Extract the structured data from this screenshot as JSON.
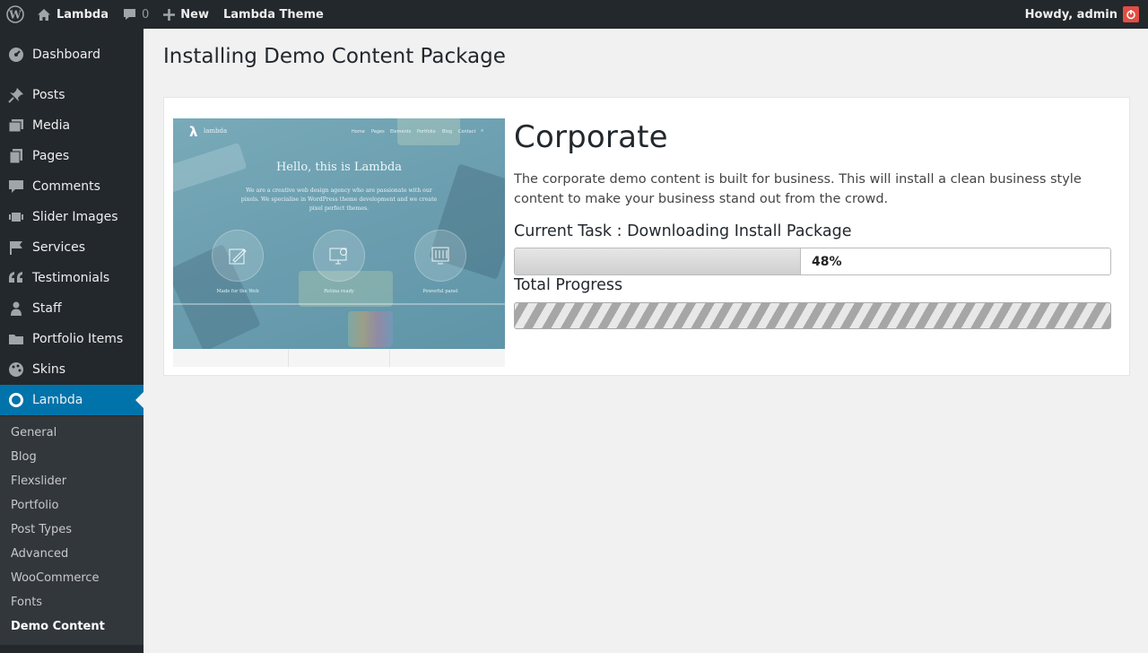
{
  "adminbar": {
    "site_name": "Lambda",
    "comments_count": "0",
    "new_label": "New",
    "theme_label": "Lambda Theme",
    "howdy": "Howdy, admin"
  },
  "sidebar": {
    "items": [
      {
        "label": "Dashboard",
        "icon": "dashboard-icon"
      },
      {
        "label": "Posts",
        "icon": "pin-icon"
      },
      {
        "label": "Media",
        "icon": "media-icon"
      },
      {
        "label": "Pages",
        "icon": "pages-icon"
      },
      {
        "label": "Comments",
        "icon": "comment-icon"
      },
      {
        "label": "Slider Images",
        "icon": "slides-icon"
      },
      {
        "label": "Services",
        "icon": "flag-icon"
      },
      {
        "label": "Testimonials",
        "icon": "quote-icon"
      },
      {
        "label": "Staff",
        "icon": "user-icon"
      },
      {
        "label": "Portfolio Items",
        "icon": "folder-icon"
      },
      {
        "label": "Skins",
        "icon": "palette-icon"
      },
      {
        "label": "Lambda",
        "icon": "circle-icon"
      }
    ],
    "submenu": [
      "General",
      "Blog",
      "Flexslider",
      "Portfolio",
      "Post Types",
      "Advanced",
      "WooCommerce",
      "Fonts",
      "Demo Content"
    ]
  },
  "main": {
    "page_title": "Installing Demo Content Package",
    "package": {
      "title": "Corporate",
      "description": "The corporate demo content is built for business. This will install a clean business style content to make your business stand out from the crowd.",
      "current_task_label": "Current Task : Downloading Install Package",
      "task_progress": 48,
      "task_progress_text": "48%",
      "total_progress_label": "Total Progress"
    },
    "thumbnail": {
      "brand": "lambda",
      "nav": [
        "Home",
        "Pages",
        "Elements",
        "Portfolio",
        "Blog",
        "Contact"
      ],
      "headline": "Hello, this is Lambda",
      "intro": "We are a creative web design agency who are passionate with our pixels. We specialise in WordPress theme development and we create pixel perfect themes.",
      "features": [
        "Made for the Web",
        "Retina ready",
        "Powerful panel"
      ]
    }
  },
  "colors": {
    "adminbar_bg": "#23282d",
    "menu_current": "#0073aa",
    "submenu_bg": "#32373c"
  }
}
